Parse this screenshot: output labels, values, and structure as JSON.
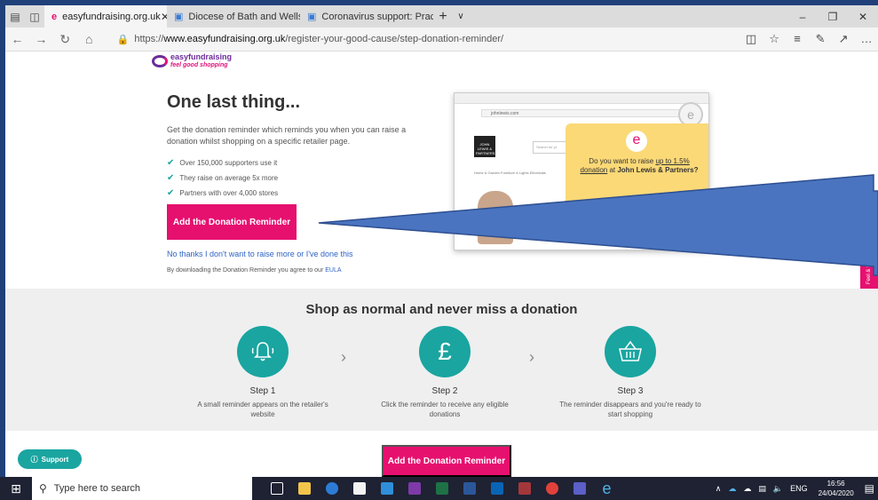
{
  "browser": {
    "tabs": [
      {
        "label": "easyfundraising.org.uk",
        "active": true
      },
      {
        "label": "Diocese of Bath and Wells",
        "active": false
      },
      {
        "label": "Coronavirus support: Practic",
        "active": false
      }
    ],
    "url_prefix": "https://",
    "url_domain": "www.easyfundraising.org.uk",
    "url_path": "/register-your-good-cause/step-donation-reminder/"
  },
  "logo": {
    "name": "easyfundraising",
    "tagline": "feel good shopping"
  },
  "main": {
    "headline": "One last thing...",
    "intro": "Get the donation reminder which reminds you when you can raise a donation whilst shopping on a specific retailer page.",
    "benefits": [
      "Over 150,000 supporters use it",
      "They raise on average 5x more",
      "Partners with over 4,000 stores"
    ],
    "cta_label": "Add the Donation Reminder",
    "decline_label": "No thanks I don't want to raise more or I've done this",
    "eula_text": "By downloading the Donation Reminder you agree to our ",
    "eula_link": "EULA"
  },
  "mock": {
    "url": "johnlewis.com",
    "brand": "JOHN LEWIS & PARTNERS",
    "search_placeholder": "Search for pr",
    "nav": "Home & Garden    Furniture & Lights    Electricals",
    "popup_pre": "Do you want to raise ",
    "popup_link": "up to 1.5% donation",
    "popup_mid": " at ",
    "popup_store": "John Lewis & Partners?"
  },
  "sidetab": "Feel & S",
  "steps": {
    "title": "Shop as normal and never miss a donation",
    "items": [
      {
        "title": "Step 1",
        "desc": "A small reminder appears on the retailer's website",
        "icon": "bell-icon"
      },
      {
        "title": "Step 2",
        "desc": "Click the reminder to receive any eligible donations",
        "icon": "pound-icon"
      },
      {
        "title": "Step 3",
        "desc": "The reminder disappears and you're ready to start shopping",
        "icon": "basket-icon"
      }
    ]
  },
  "support_label": "Support",
  "cta2_label": "Add the Donation Reminder",
  "taskbar": {
    "search_placeholder": "Type here to search",
    "lang": "ENG",
    "time": "16:56",
    "date": "24/04/2020"
  },
  "colors": {
    "accent": "#e6106f",
    "teal": "#1aa5a0",
    "brand_purple": "#6b2b9a"
  }
}
